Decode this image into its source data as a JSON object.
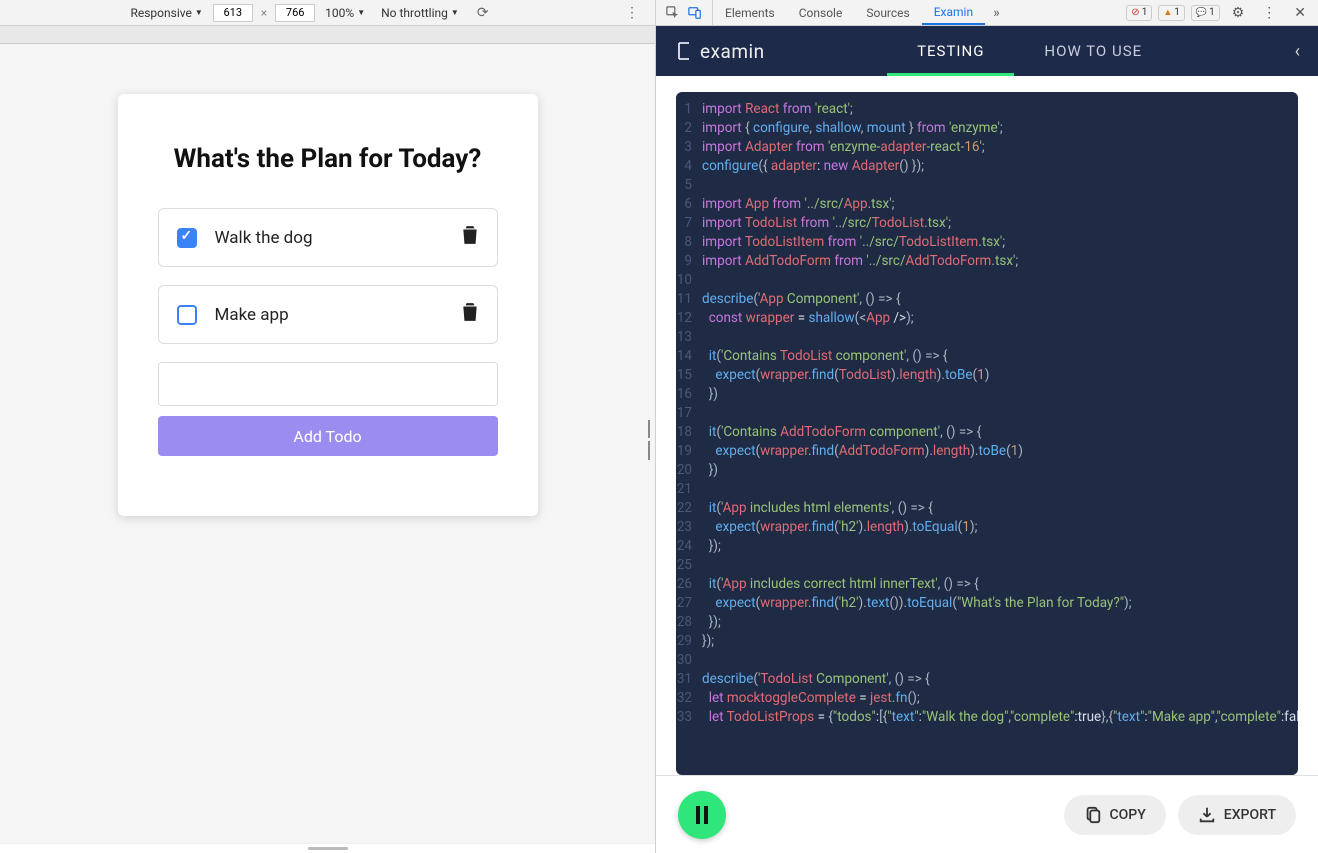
{
  "toolbar": {
    "device": "Responsive",
    "width": "613",
    "height": "766",
    "zoom": "100%",
    "throttle": "No throttling"
  },
  "devtabs": [
    "Elements",
    "Console",
    "Sources",
    "Examin"
  ],
  "devtab_active": 3,
  "badges": {
    "errors": "1",
    "warnings": "1",
    "info": "1"
  },
  "todo": {
    "title": "What's the Plan for Today?",
    "items": [
      {
        "text": "Walk the dog",
        "checked": true
      },
      {
        "text": "Make app",
        "checked": false
      }
    ],
    "input_placeholder": "",
    "add_label": "Add Todo"
  },
  "examin": {
    "logo": "examin",
    "tabs": [
      "TESTING",
      "HOW TO USE"
    ],
    "tab_active": 0,
    "copy": "COPY",
    "export": "EXPORT"
  },
  "code_lines": [
    "import React from 'react';",
    "import { configure, shallow, mount } from 'enzyme';",
    "import Adapter from 'enzyme-adapter-react-16';",
    "configure({ adapter: new Adapter() });",
    "",
    "import App from '../src/App.tsx';",
    "import TodoList from '../src/TodoList.tsx';",
    "import TodoListItem from '../src/TodoListItem.tsx';",
    "import AddTodoForm from '../src/AddTodoForm.tsx';",
    "",
    "describe('App Component', () => {",
    "  const wrapper = shallow(<App />);",
    "",
    "  it('Contains TodoList component', () => {",
    "    expect(wrapper.find(TodoList).length).toBe(1)",
    "  })",
    "",
    "  it('Contains AddTodoForm component', () => {",
    "    expect(wrapper.find(AddTodoForm).length).toBe(1)",
    "  })",
    "",
    "  it('App includes html elements', () => {",
    "    expect(wrapper.find('h2').length).toEqual(1);",
    "  });",
    "",
    "  it('App includes correct html innerText', () => {",
    "    expect(wrapper.find('h2').text()).toEqual(\"What's the Plan for Today?\");",
    "  });",
    "});",
    "",
    "describe('TodoList Component', () => {",
    "  let mocktoggleComplete = jest.fn();",
    "  let TodoListProps = {\"todos\":[{\"text\":\"Walk the dog\",\"complete\":true},{\"text\":\"Make app\",\"complete\":false}],\"toggleComplete\":mocktoggleComplete};"
  ]
}
